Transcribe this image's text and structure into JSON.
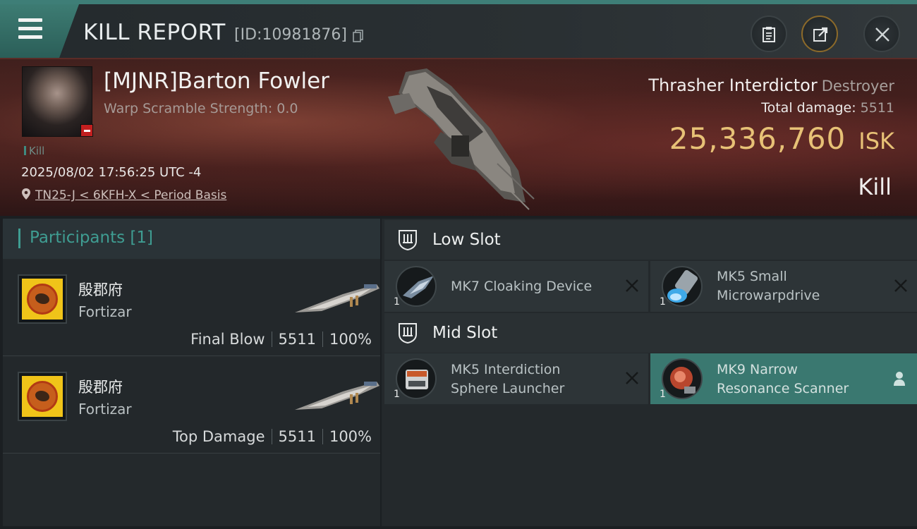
{
  "header": {
    "title": "KILL REPORT",
    "report_id": "[ID:10981876]",
    "menu_icon": "hamburger-menu-icon",
    "buttons": [
      "clipboard-icon",
      "share-external-icon",
      "close-icon"
    ]
  },
  "victim": {
    "name": "[MJNR]Barton Fowler",
    "warp_scramble": "Warp Scramble Strength: 0.0",
    "tag": "Kill",
    "datetime": "2025/08/02 17:56:25 UTC -4",
    "location": "TN25-J < 6KFH-X < Period Basis",
    "ship_name": "Thrasher Interdictor",
    "ship_class": "Destroyer",
    "total_damage_label": "Total damage:",
    "total_damage": "5511",
    "isk_value": "25,336,760",
    "isk_unit": "ISK",
    "result": "Kill"
  },
  "participants": {
    "title": "Participants [1]",
    "rows": [
      {
        "corp": "殷郡府",
        "ship": "Fortizar",
        "role": "Final Blow",
        "damage": "5511",
        "percent": "100%"
      },
      {
        "corp": "殷郡府",
        "ship": "Fortizar",
        "role": "Top Damage",
        "damage": "5511",
        "percent": "100%"
      }
    ]
  },
  "slots": {
    "low": {
      "title": "Low Slot",
      "modules": [
        {
          "qty": "1",
          "line1": "MK7 Cloaking Device",
          "line2": "",
          "status": "destroyed"
        },
        {
          "qty": "1",
          "line1": "MK5 Small",
          "line2": "Microwarpdrive",
          "status": "destroyed"
        }
      ]
    },
    "mid": {
      "title": "Mid Slot",
      "modules": [
        {
          "qty": "1",
          "line1": "MK5 Interdiction",
          "line2": "Sphere Launcher",
          "status": "destroyed"
        },
        {
          "qty": "1",
          "line1": "MK9 Narrow",
          "line2": "Resonance Scanner",
          "status": "dropped"
        }
      ]
    }
  },
  "colors": {
    "accent": "#3f9d92",
    "isk_gold": "#e7c176",
    "banner_red": "#4a2320",
    "panel": "#24292c"
  }
}
